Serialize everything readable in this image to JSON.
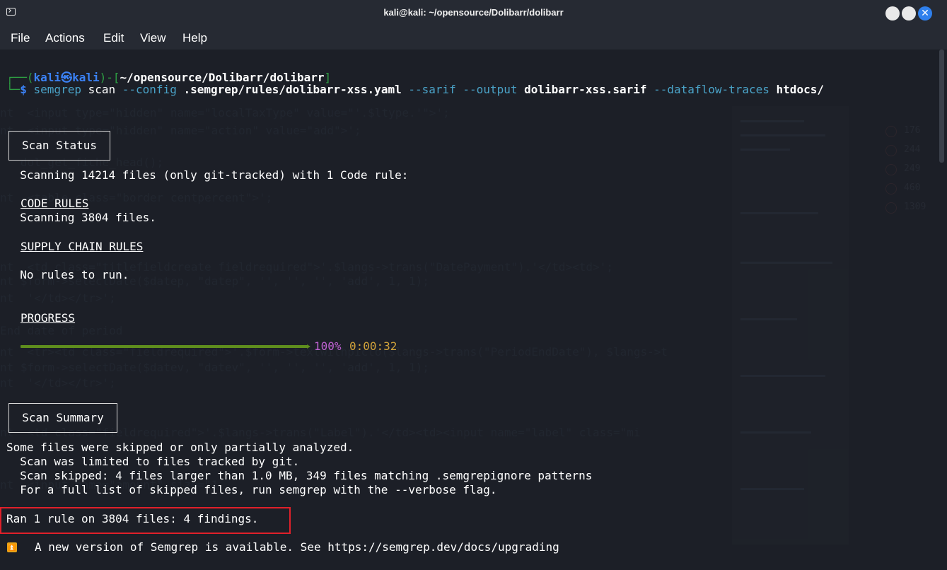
{
  "window": {
    "title": "kali@kali: ~/opensource/Dolibarr/dolibarr",
    "close_glyph": "✕"
  },
  "menu": {
    "file": "File",
    "actions": "Actions",
    "edit": "Edit",
    "view": "View",
    "help": "Help"
  },
  "prompt": {
    "open": "┌──(",
    "user": "kali㉿kali",
    "mid": ")-[",
    "path": "~/opensource/Dolibarr/dolibarr",
    "close": "]",
    "second_prefix": "└─",
    "dollar": "$ ",
    "cmd_semgrep": "semgrep",
    "cmd_scan": " scan ",
    "flag_config": "--config",
    "arg_config": " .semgrep/rules/dolibarr-xss.yaml ",
    "flag_sarif": "--sarif",
    "flag_output": " --output",
    "arg_output": " dolibarr-xss.sarif ",
    "flag_dataflow": "--dataflow-traces",
    "arg_dir": " htdocs/"
  },
  "scan_status": {
    "box_label": "Scan Status",
    "scanning_line": "  Scanning 14214 files (only git-tracked) with 1 Code rule:",
    "code_rules_heading": "CODE RULES",
    "code_rules_line": "  Scanning 3804 files.",
    "supply_chain_heading": "SUPPLY CHAIN RULES",
    "no_rules_line": "  No rules to run.",
    "progress_heading": "PROGRESS",
    "progress_percent": "100%",
    "progress_time": "0:00:32",
    "progress_fraction": 1.0
  },
  "scan_summary": {
    "box_label": "Scan Summary",
    "line1": "Some files were skipped or only partially analyzed.",
    "line2": "  Scan was limited to files tracked by git.",
    "line3": "  Scan skipped: 4 files larger than 1.0 MB, 349 files matching .semgrepignore patterns",
    "line4": "  For a full list of skipped files, run semgrep with the --verbose flag.",
    "findings": "Ran 1 rule on 3804 files: 4 findings.",
    "notice_icon": "⏫",
    "notice": "A new version of Semgrep is available. See https://semgrep.dev/docs/upgrading"
  },
  "colors": {
    "background": "#1c1f27",
    "prompt_blue": "#3b82f6",
    "prompt_green": "#2ea043",
    "progress_green": "#5f8e1d",
    "percent_magenta": "#c162d4",
    "time_orange": "#d1a33b",
    "highlight_red": "#e0202a"
  }
}
